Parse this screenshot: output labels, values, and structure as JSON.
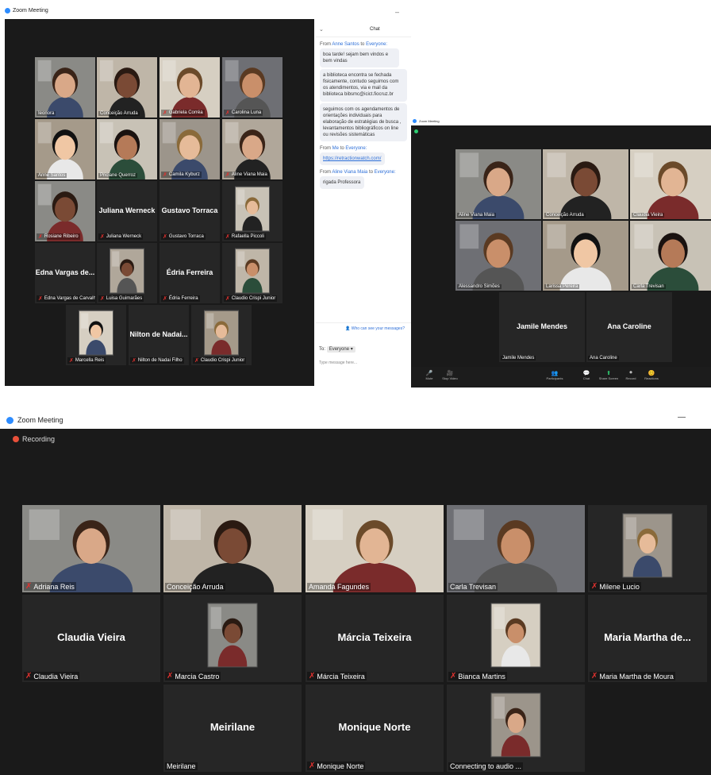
{
  "window1": {
    "title": "Zoom Meeting",
    "tiles": [
      {
        "name": "Ieonora",
        "label": "",
        "type": "video",
        "muted": false
      },
      {
        "name": "Conceição Arruda",
        "label": "",
        "type": "video",
        "muted": false
      },
      {
        "name": "Gabriela Corréa",
        "label": "",
        "type": "video",
        "muted": true
      },
      {
        "name": "Carolina Luna",
        "label": "",
        "type": "video",
        "muted": true
      },
      {
        "name": "Anne Santos",
        "label": "",
        "type": "video",
        "muted": false,
        "active": true
      },
      {
        "name": "Priciane Querroz",
        "label": "",
        "type": "video",
        "muted": false
      },
      {
        "name": "Camila Kyburz",
        "label": "",
        "type": "video",
        "muted": true
      },
      {
        "name": "Aline Viana Maia",
        "label": "",
        "type": "video",
        "muted": true
      },
      {
        "name": "Rosiane Ribeiro",
        "label": "",
        "type": "video",
        "muted": true
      },
      {
        "name": "Juliana Werneck",
        "label": "Juliana Werneck",
        "type": "name",
        "muted": true
      },
      {
        "name": "Gustavo Torraca",
        "label": "Gustavo Torraca",
        "type": "name",
        "muted": true
      },
      {
        "name": "Rafaella Piccoli",
        "label": "",
        "type": "thumb",
        "muted": true
      },
      {
        "name": "Edna Vargas de Carvalho",
        "label": "Edna Vargas de...",
        "type": "name",
        "muted": true
      },
      {
        "name": "Luisa Guimarães",
        "label": "",
        "type": "thumb",
        "muted": true
      },
      {
        "name": "Édria Ferreira",
        "label": "Édria Ferreira",
        "type": "name",
        "muted": true
      },
      {
        "name": "Claudio Crispi Junior",
        "label": "",
        "type": "thumb",
        "muted": true
      },
      {
        "name": "Marcella Reis",
        "label": "",
        "type": "thumb",
        "muted": true
      },
      {
        "name": "Nilton de Nadai Filho",
        "label": "Nilton de Nadai...",
        "type": "name",
        "muted": true
      },
      {
        "name": "Claudio Crispi Junior",
        "label": "",
        "type": "thumb",
        "muted": true
      }
    ]
  },
  "chat": {
    "title": "Chat",
    "messages": [
      {
        "from": "From",
        "sender": "Anne Santos",
        "to": "to",
        "recipient": "Everyone:",
        "bubbles": [
          "boa tarde! sejam bem vindos e bem vindas",
          "a biblioteca encontra se fechada fisicamente, contudo seguimos com os atendimentos, via e mail da biblioteca bibsmc@icict.fiocruz.br",
          "seguimos com os agendamentos de orientações individuais para elaboração de estratégias de busca , levantamentos bibliográficos on line ou revisões sistemáticas"
        ]
      },
      {
        "from": "From",
        "sender": "Me",
        "to": "to",
        "recipient": "Everyone:",
        "link": "https://retractionwatch.com/"
      },
      {
        "from": "From",
        "sender": "Aline Viana Maia",
        "to": "to",
        "recipient": "Everyone:",
        "bubbles": [
          "rigada Professora"
        ]
      }
    ],
    "who_can_see": "Who can see your messages?",
    "to_label": "To:",
    "to_value": "Everyone ▾",
    "input_placeholder": "Type message here..."
  },
  "window2": {
    "title": "Zoom Meeting",
    "tiles": [
      {
        "name": "Aline Viana Maia",
        "type": "video"
      },
      {
        "name": "Conceição Arruda",
        "type": "video"
      },
      {
        "name": "Claudia Vieira",
        "type": "video",
        "active": true
      },
      {
        "name": "Alessandro Simões",
        "type": "video"
      },
      {
        "name": "Larissa Pereira",
        "type": "video"
      },
      {
        "name": "Carla Trevisan",
        "type": "video"
      },
      {
        "name": "Jamile Mendes",
        "label": "Jamile Mendes",
        "type": "name"
      },
      {
        "name": "Ana Caroline",
        "label": "Ana Caroline",
        "type": "name"
      }
    ],
    "toolbar": [
      "Mute",
      "Stop Video",
      "Participants",
      "Chat",
      "Share Screen",
      "Record",
      "Reactions"
    ]
  },
  "window3": {
    "title": "Zoom Meeting",
    "minimize": "—",
    "recording": "Recording",
    "tiles": [
      {
        "name": "Adriana Reis",
        "type": "video",
        "muted": true
      },
      {
        "name": "Conceição Arruda",
        "type": "video",
        "muted": false
      },
      {
        "name": "Amanda Fagundes",
        "type": "video",
        "muted": false
      },
      {
        "name": "Carla Trevisan",
        "type": "video",
        "muted": false,
        "active": true
      },
      {
        "name": "Milene Lucio",
        "type": "thumb",
        "muted": true
      },
      {
        "name": "Claudia Vieira",
        "label": "Claudia Vieira",
        "type": "name",
        "muted": true
      },
      {
        "name": "Marcia Castro",
        "type": "thumb",
        "muted": true
      },
      {
        "name": "Márcia Teixeira",
        "label": "Márcia Teixeira",
        "type": "name",
        "muted": true
      },
      {
        "name": "Bianca Martins",
        "type": "thumb",
        "muted": true
      },
      {
        "name": "Maria Martha de Moura",
        "label": "Maria Martha de...",
        "type": "name",
        "muted": true
      },
      {
        "name": "Meirilane",
        "label": "Meirilane",
        "type": "name",
        "muted": false
      },
      {
        "name": "Monique Norte",
        "label": "Monique Norte",
        "type": "name",
        "muted": true
      },
      {
        "name": "Connecting to audio ...",
        "type": "thumb",
        "muted": false
      }
    ]
  }
}
